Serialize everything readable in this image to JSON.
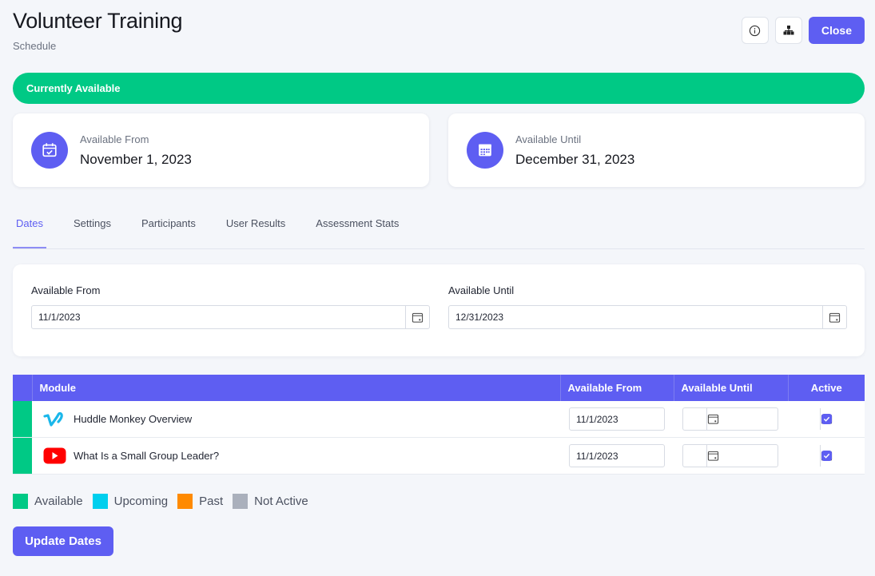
{
  "header": {
    "title": "Volunteer Training",
    "subtitle": "Schedule",
    "info_icon": "info-circle-icon",
    "structure_icon": "hierarchy-icon",
    "close_label": "Close"
  },
  "status_banner": {
    "text": "Currently Available",
    "color": "#00c985"
  },
  "cards": {
    "from": {
      "label": "Available From",
      "value": "November 1, 2023",
      "icon": "calendar-check-icon"
    },
    "until": {
      "label": "Available Until",
      "value": "December 31, 2023",
      "icon": "calendar-grid-icon"
    }
  },
  "tabs": [
    {
      "label": "Dates",
      "active": true
    },
    {
      "label": "Settings",
      "active": false
    },
    {
      "label": "Participants",
      "active": false
    },
    {
      "label": "User Results",
      "active": false
    },
    {
      "label": "Assessment Stats",
      "active": false
    }
  ],
  "dates_panel": {
    "from_label": "Available From",
    "from_value": "11/1/2023",
    "until_label": "Available Until",
    "until_value": "12/31/2023"
  },
  "table": {
    "headers": [
      "Module",
      "Available From",
      "Available Until",
      "Active"
    ],
    "rows": [
      {
        "source": "vimeo",
        "icon": "vimeo-icon",
        "name": "Huddle Monkey Overview",
        "from": "11/1/2023",
        "until": "",
        "active": true,
        "status": "Available"
      },
      {
        "source": "youtube",
        "icon": "youtube-icon",
        "name": "What Is a Small Group Leader?",
        "from": "11/1/2023",
        "until": "",
        "active": true,
        "status": "Available"
      }
    ]
  },
  "legend": [
    {
      "label": "Available",
      "color": "#00c985"
    },
    {
      "label": "Upcoming",
      "color": "#00cfee"
    },
    {
      "label": "Past",
      "color": "#ff8a00"
    },
    {
      "label": "Not Active",
      "color": "#aab0bc"
    }
  ],
  "update_button": "Update Dates",
  "colors": {
    "accent": "#5e5ef2",
    "available": "#00c985"
  }
}
